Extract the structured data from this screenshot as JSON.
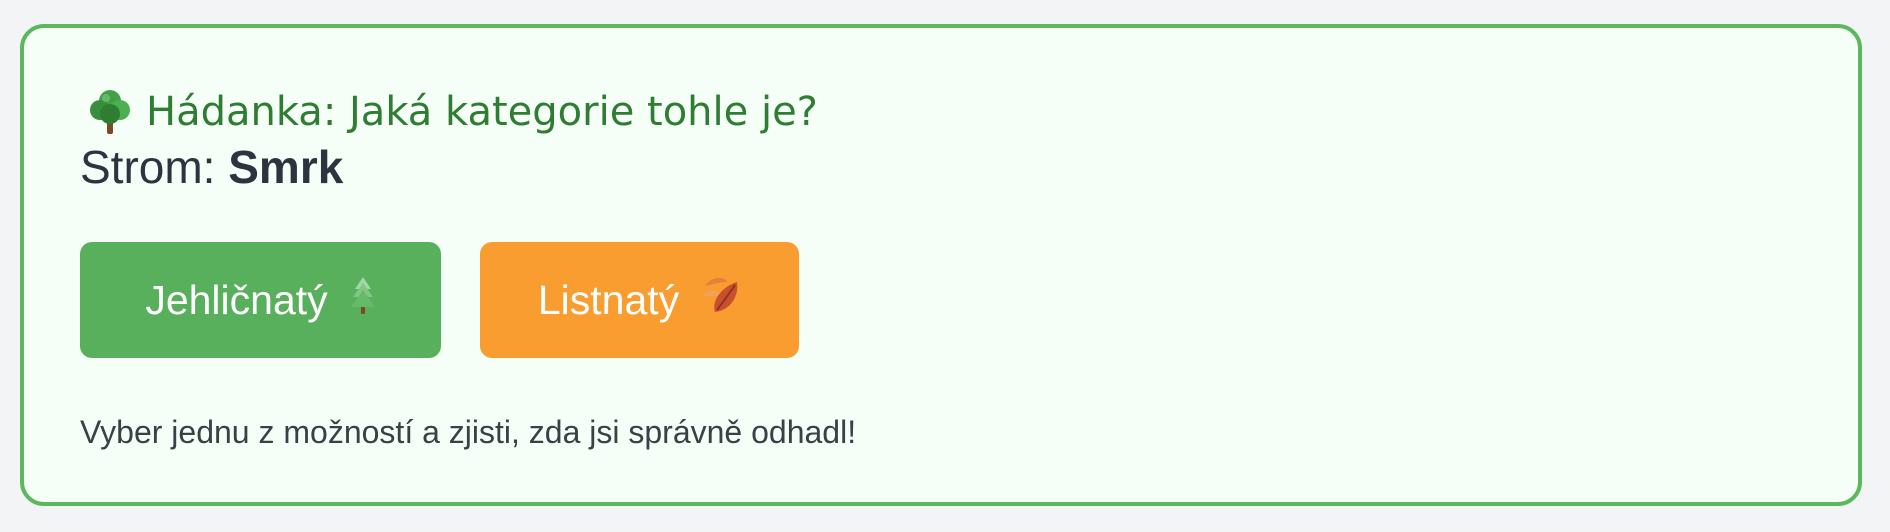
{
  "riddle": {
    "title": "Hádanka: Jaká kategorie tohle je?",
    "title_icon": "deciduous-tree-icon",
    "tree_label": "Strom:",
    "tree_name": "Smrk"
  },
  "buttons": {
    "conifer": {
      "label": "Jehličnatý",
      "icon": "evergreen-tree-icon",
      "color": "#58b05c"
    },
    "deciduous": {
      "label": "Listnatý",
      "icon": "fallen-leaf-icon",
      "color": "#f99d30"
    }
  },
  "hint": "Vyber jednu z možností a zjisti, zda jsi správně odhadl!",
  "colors": {
    "border": "#5cb85c",
    "card_background": "#f6fff7",
    "title": "#2e7d32",
    "page_background": "#f3f4f6"
  }
}
